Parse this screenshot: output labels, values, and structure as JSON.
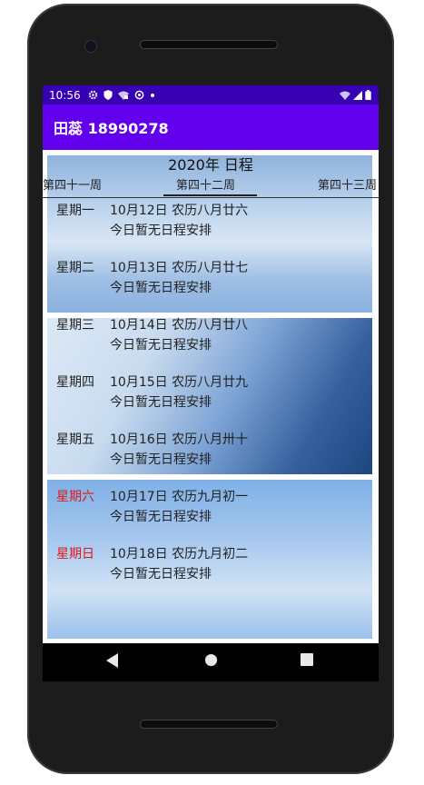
{
  "status_bar": {
    "time": "10:56",
    "icons": [
      "gear-icon",
      "shield-icon",
      "wifi-lock-icon",
      "sync-icon",
      "dot-icon"
    ],
    "right_icons": [
      "wifi-icon",
      "signal-icon",
      "battery-icon"
    ]
  },
  "app_bar": {
    "title": "田蕊 18990278",
    "color": "#6200ee",
    "status_color": "#3700b3"
  },
  "schedule": {
    "header": "2020年 日程",
    "weeks": {
      "prev": "第四十一周",
      "current": "第四十二周",
      "next": "第四十三周"
    },
    "days": [
      {
        "weekday": "星期一",
        "date": "10月12日 农历八月廿六",
        "note": "今日暂无日程安排",
        "weekend": false
      },
      {
        "weekday": "星期二",
        "date": "10月13日 农历八月廿七",
        "note": "今日暂无日程安排",
        "weekend": false
      },
      {
        "weekday": "星期三",
        "date": "10月14日 农历八月廿八",
        "note": "今日暂无日程安排",
        "weekend": false
      },
      {
        "weekday": "星期四",
        "date": "10月15日 农历八月廿九",
        "note": "今日暂无日程安排",
        "weekend": false
      },
      {
        "weekday": "星期五",
        "date": "10月16日 农历八月卅十",
        "note": "今日暂无日程安排",
        "weekend": false
      },
      {
        "weekday": "星期六",
        "date": "10月17日 农历九月初一",
        "note": "今日暂无日程安排",
        "weekend": true
      },
      {
        "weekday": "星期日",
        "date": "10月18日 农历九月初二",
        "note": "今日暂无日程安排",
        "weekend": true
      }
    ],
    "weekend_color": "#e01818"
  },
  "nav_bar": {
    "buttons": [
      "back-icon",
      "home-icon",
      "recents-icon"
    ]
  }
}
